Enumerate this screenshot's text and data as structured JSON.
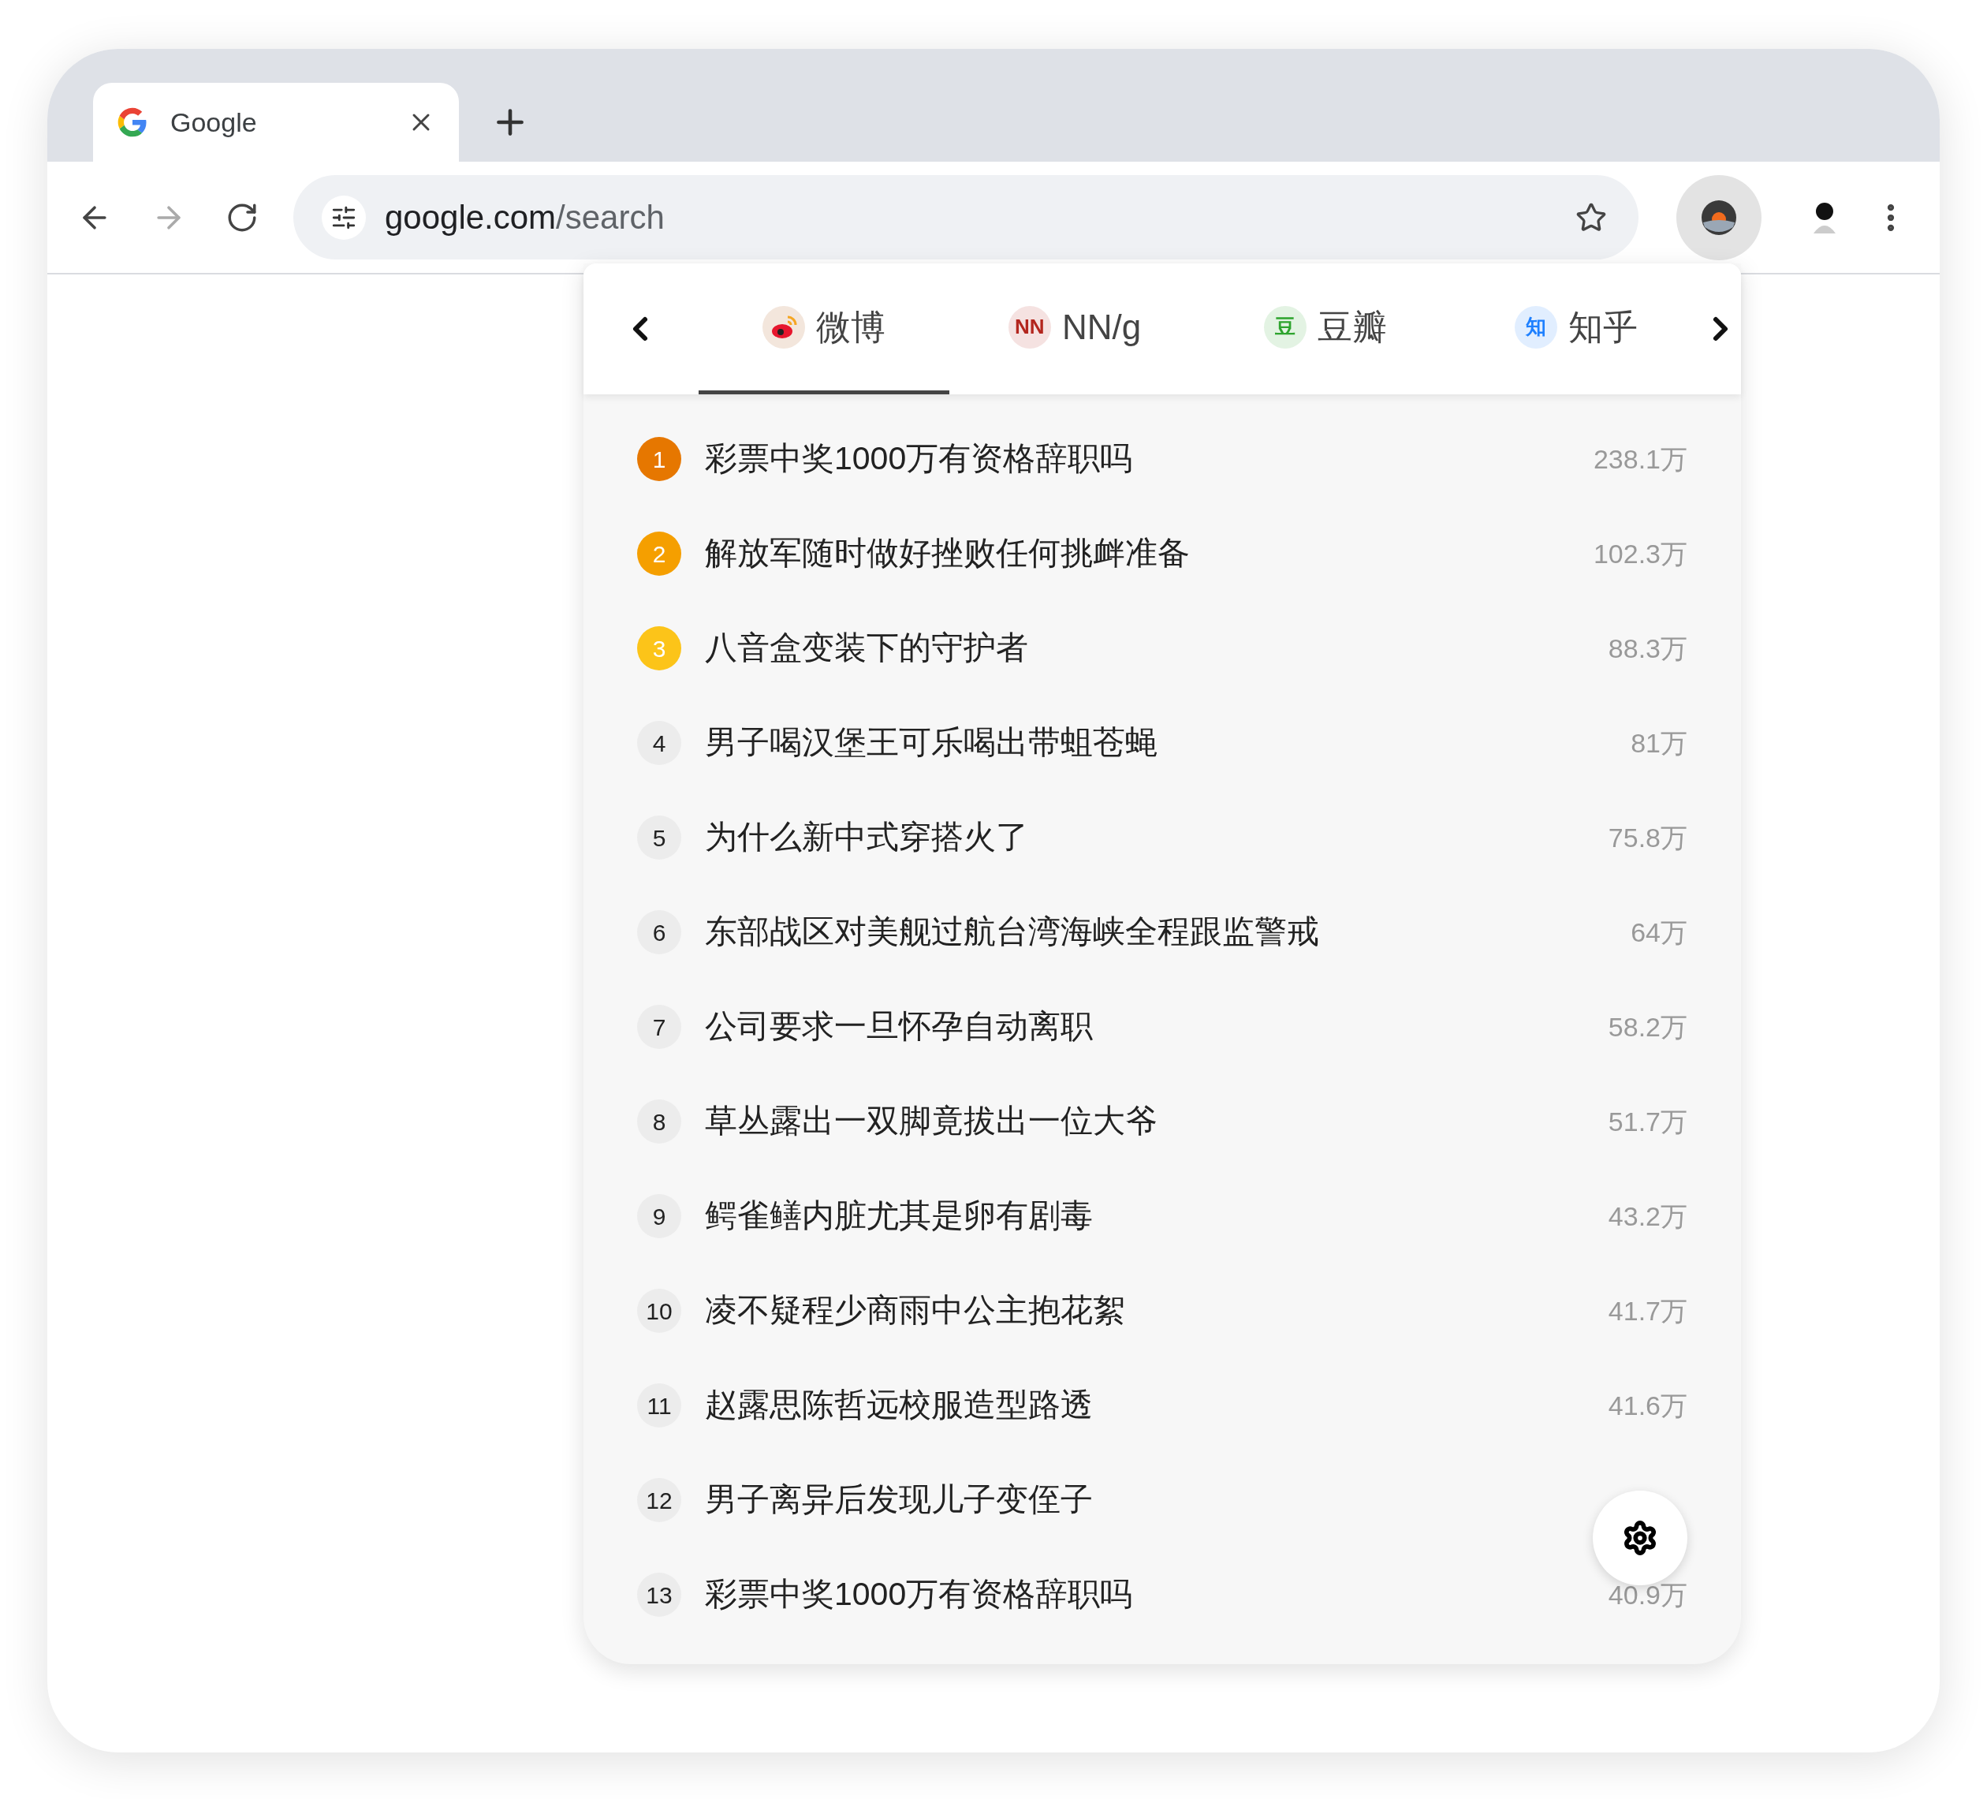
{
  "browser": {
    "tabs": [
      {
        "title": "Google",
        "selected": true
      }
    ],
    "address": {
      "domain": "google.com",
      "path": "/search"
    }
  },
  "panel": {
    "sources": [
      {
        "kind": "weibo",
        "label": "微博",
        "selected": true
      },
      {
        "kind": "badge",
        "badge": "NN",
        "color": "#b3261e",
        "label": "NN/g",
        "selected": false
      },
      {
        "kind": "badge",
        "badge": "豆",
        "color": "#2ea42e",
        "label": "豆瓣",
        "selected": false
      },
      {
        "kind": "badge",
        "badge": "知",
        "color": "#1e80ff",
        "label": "知乎",
        "selected": false
      }
    ],
    "items": [
      {
        "rank": "1",
        "color": "#e67700",
        "title": "彩票中奖1000万有资格辞职吗",
        "count": "238.1万"
      },
      {
        "rank": "2",
        "color": "#f59f00",
        "title": "解放军随时做好挫败任何挑衅准备",
        "count": "102.3万"
      },
      {
        "rank": "3",
        "color": "#fcc419",
        "title": "八音盒变装下的守护者",
        "count": "88.3万"
      },
      {
        "rank": "4",
        "title": "男子喝汉堡王可乐喝出带蛆苍蝇",
        "count": "81万"
      },
      {
        "rank": "5",
        "title": "为什么新中式穿搭火了",
        "count": "75.8万"
      },
      {
        "rank": "6",
        "title": "东部战区对美舰过航台湾海峡全程跟监警戒",
        "count": "64万"
      },
      {
        "rank": "7",
        "title": "公司要求一旦怀孕自动离职",
        "count": "58.2万"
      },
      {
        "rank": "8",
        "title": "草丛露出一双脚竟拔出一位大爷",
        "count": "51.7万"
      },
      {
        "rank": "9",
        "title": "鳄雀鳝内脏尤其是卵有剧毒",
        "count": "43.2万"
      },
      {
        "rank": "10",
        "title": "凌不疑程少商雨中公主抱花絮",
        "count": "41.7万"
      },
      {
        "rank": "11",
        "title": "赵露思陈哲远校服造型路透",
        "count": "41.6万"
      },
      {
        "rank": "12",
        "title": "男子离异后发现儿子变侄子"
      },
      {
        "rank": "13",
        "title": "彩票中奖1000万有资格辞职吗",
        "count": "40.9万"
      }
    ]
  }
}
